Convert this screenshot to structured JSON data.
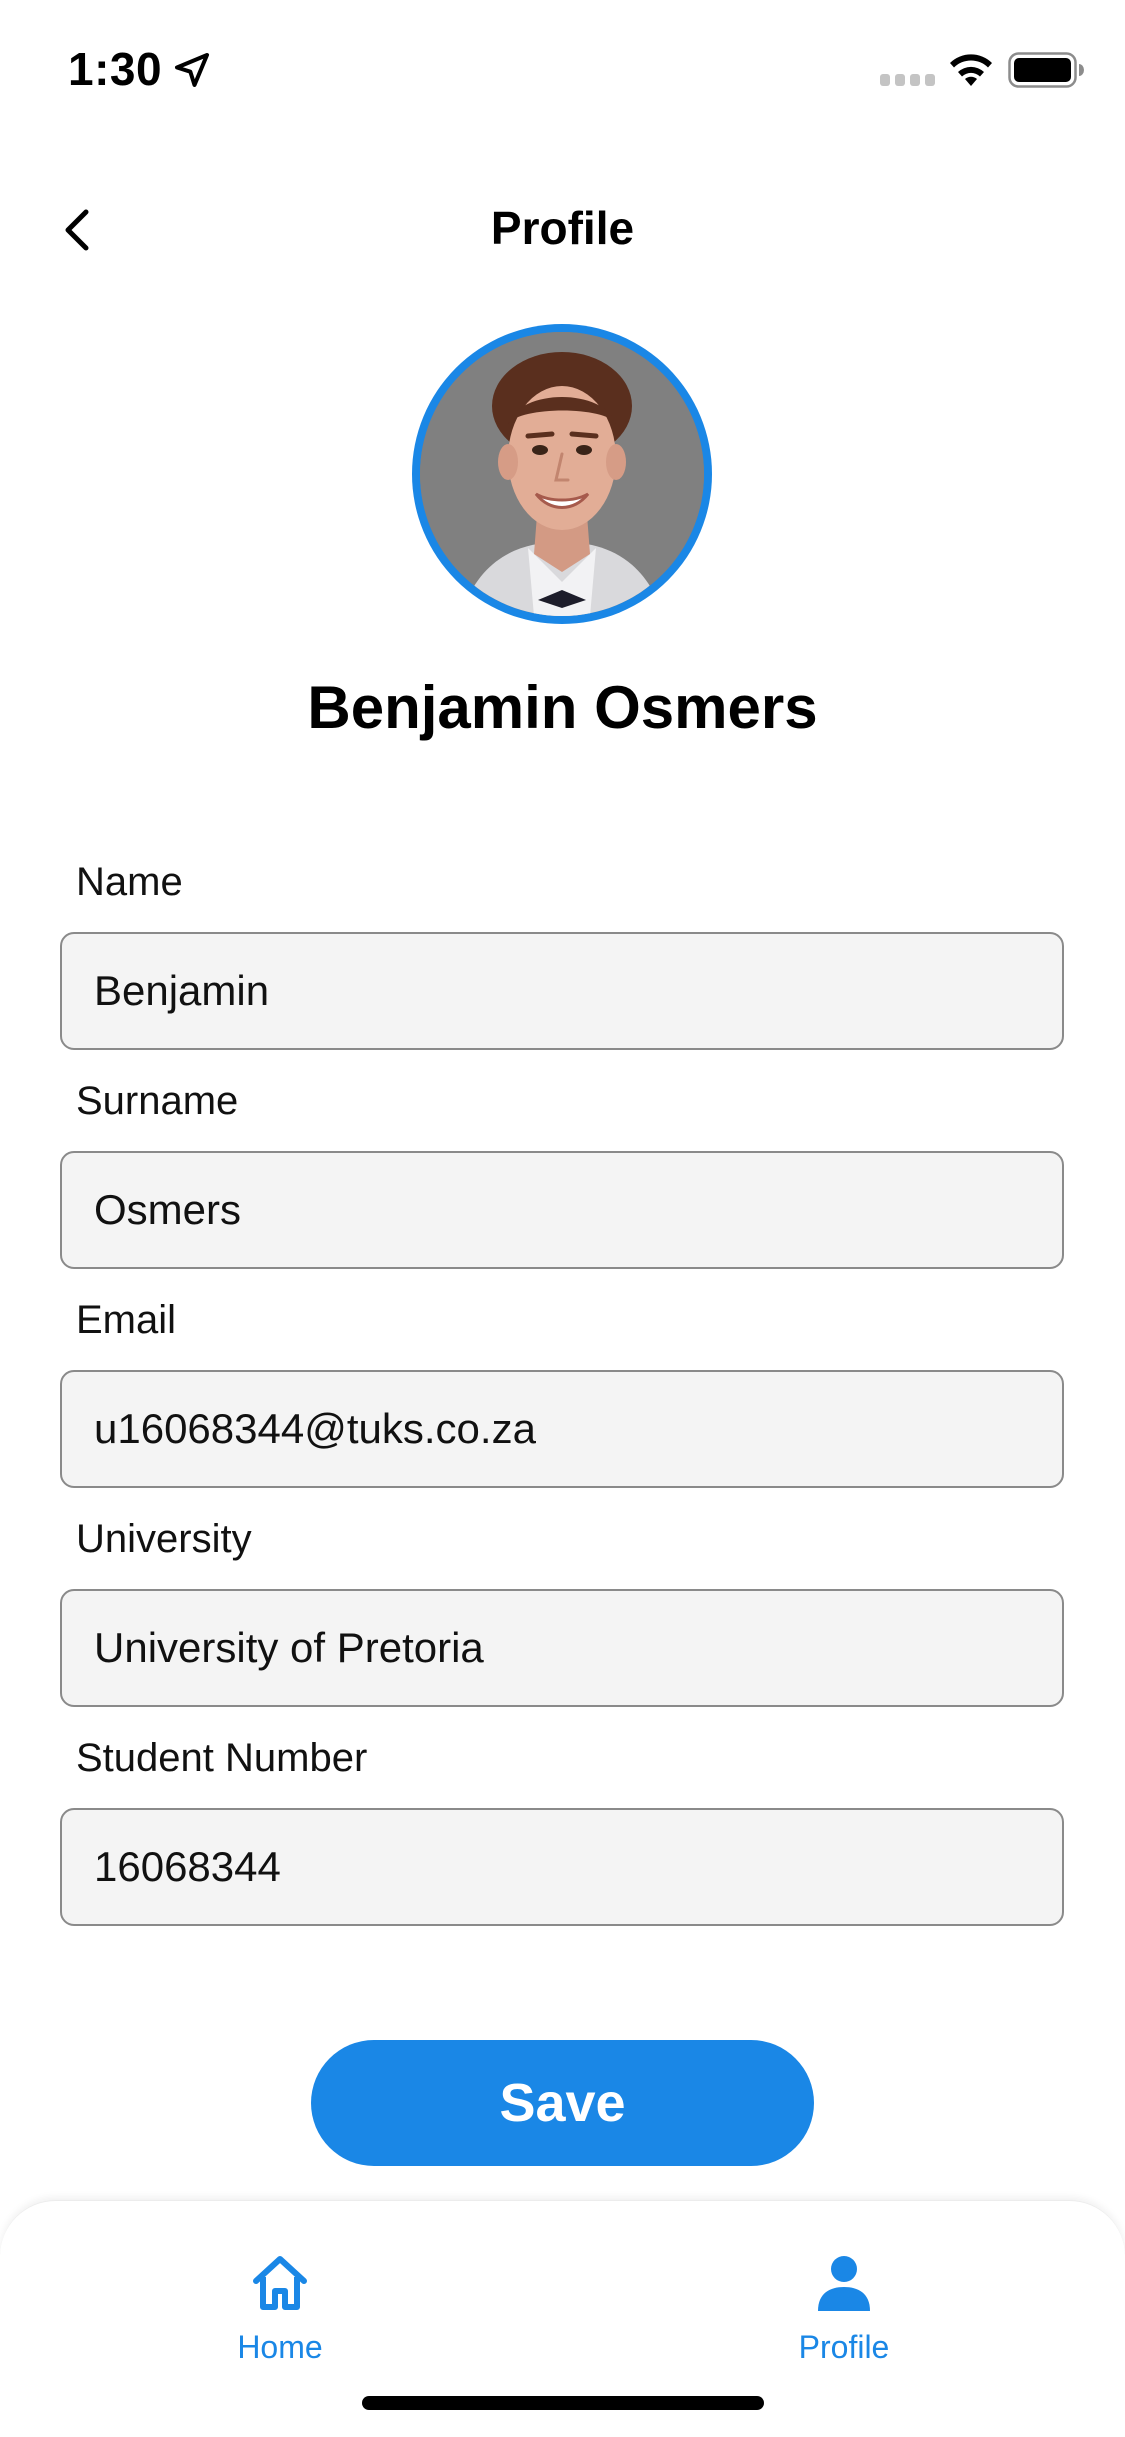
{
  "status_bar": {
    "time": "1:30",
    "icons": [
      "location-arrow-icon",
      "cellular-signal-icon",
      "wifi-icon",
      "battery-icon"
    ]
  },
  "header": {
    "title": "Profile",
    "back_icon": "chevron-left-icon"
  },
  "profile": {
    "display_name": "Benjamin Osmers",
    "avatar_ring_color": "#1a87e6"
  },
  "form": {
    "fields": [
      {
        "label": "Name",
        "value": "Benjamin"
      },
      {
        "label": "Surname",
        "value": "Osmers"
      },
      {
        "label": "Email",
        "value": "u16068344@tuks.co.za"
      },
      {
        "label": "University",
        "value": "University of Pretoria"
      },
      {
        "label": "Student Number",
        "value": "16068344"
      }
    ],
    "save_label": "Save"
  },
  "tab_bar": {
    "items": [
      {
        "label": "Home",
        "icon": "home-icon"
      },
      {
        "label": "Profile",
        "icon": "person-icon"
      }
    ],
    "accent_color": "#1a87e6"
  }
}
